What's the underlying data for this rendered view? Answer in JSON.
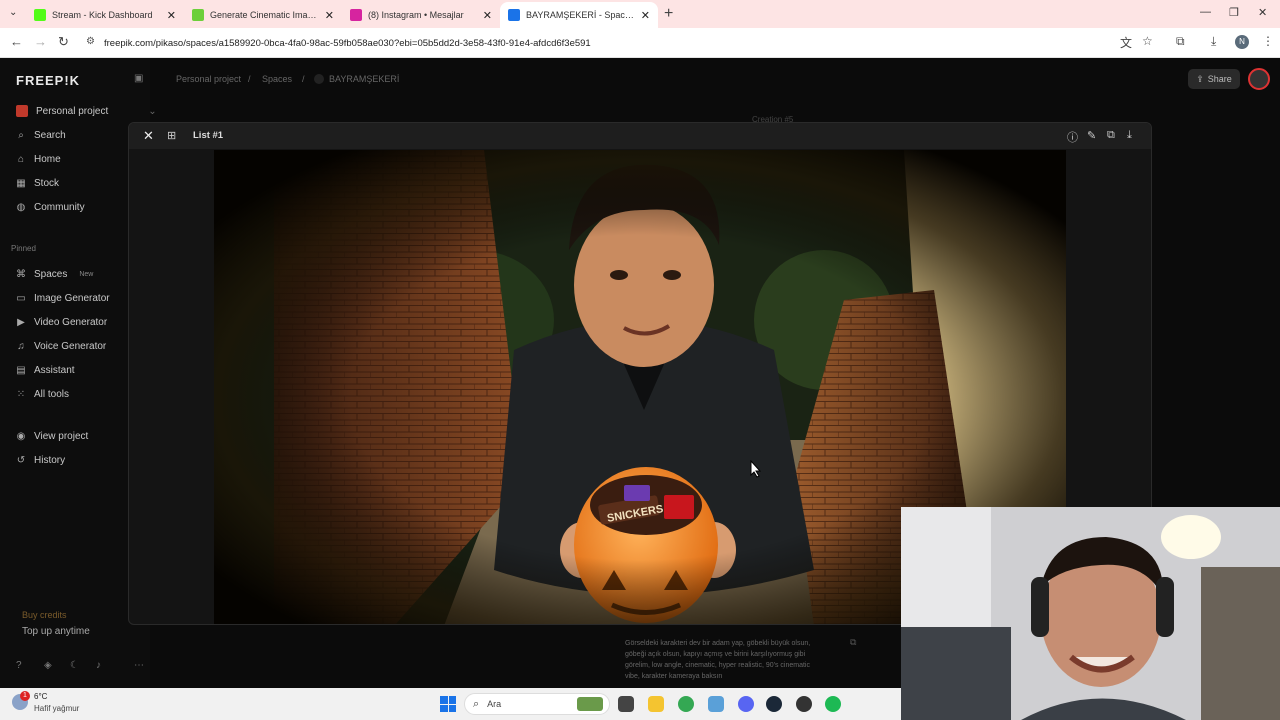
{
  "browser": {
    "tabs": [
      {
        "title": "Stream - Kick Dashboard",
        "favicon_color": "#53fc18",
        "active": false
      },
      {
        "title": "Generate Cinematic Images with",
        "favicon_color": "#6ccf3a",
        "active": false
      },
      {
        "title": "(8) Instagram • Mesajlar",
        "favicon_color": "#d6249f",
        "active": false
      },
      {
        "title": "BAYRAMŞEKERİ - Spaces | Freep",
        "favicon_color": "#1a73e8",
        "active": true
      }
    ],
    "url": "freepik.com/pikaso/spaces/a1589920-0bca-4fa0-98ac-59fb058ae030?ebi=05b5dd2d-3e58-43f0-91e4-afdcd6f3e591",
    "profile_initial": "N"
  },
  "sidebar": {
    "logo": "FREEP!K",
    "project": "Personal project",
    "items": [
      {
        "label": "Search",
        "icon": "search-icon"
      },
      {
        "label": "Home",
        "icon": "home-icon"
      },
      {
        "label": "Stock",
        "icon": "stock-icon"
      },
      {
        "label": "Community",
        "icon": "globe-icon"
      }
    ],
    "pinned_label": "Pinned",
    "pinned": [
      {
        "label": "Spaces",
        "badge": "New",
        "icon": "spaces-icon"
      },
      {
        "label": "Image Generator",
        "icon": "image-icon"
      },
      {
        "label": "Video Generator",
        "icon": "video-icon"
      },
      {
        "label": "Voice Generator",
        "icon": "mic-icon"
      },
      {
        "label": "Assistant",
        "icon": "chat-icon"
      },
      {
        "label": "All tools",
        "icon": "grid-icon"
      }
    ],
    "links": [
      {
        "label": "View project",
        "icon": "eye-icon"
      },
      {
        "label": "History",
        "icon": "history-icon"
      }
    ],
    "buy_credits": "Buy credits",
    "top_up": "Top up anytime"
  },
  "header": {
    "breadcrumbs": [
      "Personal project",
      "/",
      "Spaces",
      "/",
      "BAYRAMŞEKERİ"
    ],
    "share": "Share"
  },
  "modal": {
    "title": "List #1",
    "behind_label": "Creation #5"
  },
  "prompt_text": "Görseldeki karakteri dev bir adam yap, göbekli büyük olsun, göbeği açık olsun, kapıyı açmış ve birini karşılıyormuş gibi görelim, low angle, cinematic, hyper realistic, 90's cinematic vibe, karakter kameraya baksın",
  "taskbar": {
    "temp": "6°C",
    "weather": "Hafif yağmur",
    "notif": "1",
    "search": "Ara"
  }
}
